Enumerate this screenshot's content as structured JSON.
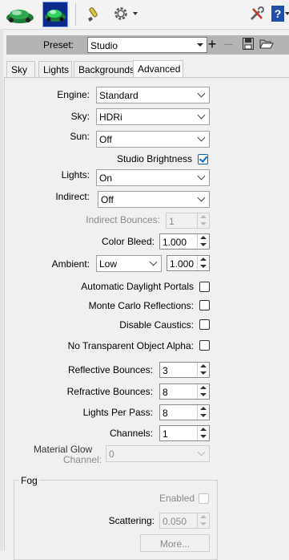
{
  "toolbar": {
    "icons": [
      "car-render-icon",
      "car-render-active-icon",
      "paint-brush-icon",
      "gear-icon",
      "tools-icon",
      "help-icon"
    ],
    "colors": {
      "car_green": "#2fa84f",
      "active_bg": "#0b2a8a",
      "brush_yellow": "#d8c44a"
    }
  },
  "preset": {
    "label": "Preset:",
    "value": "Studio"
  },
  "tabs": [
    "Sky",
    "Lights",
    "Backgrounds",
    "Advanced"
  ],
  "advanced": {
    "engine": {
      "label": "Engine:",
      "value": "Standard"
    },
    "sky": {
      "label": "Sky:",
      "value": "HDRi"
    },
    "sun": {
      "label": "Sun:",
      "value": "Off"
    },
    "studio_brightness": {
      "label": "Studio Brightness",
      "checked": true
    },
    "lights": {
      "label": "Lights:",
      "value": "On"
    },
    "indirect": {
      "label": "Indirect:",
      "value": "Off"
    },
    "indirect_bounces": {
      "label": "Indirect Bounces:",
      "value": "1"
    },
    "color_bleed": {
      "label": "Color Bleed:",
      "value": "1.000"
    },
    "ambient": {
      "label": "Ambient:",
      "value": "Low",
      "amount": "1.000"
    },
    "automatic_daylight_portals": {
      "label": "Automatic Daylight Portals",
      "checked": false
    },
    "monte_carlo_reflections": {
      "label": "Monte Carlo Reflections:",
      "checked": false
    },
    "disable_caustics": {
      "label": "Disable Caustics:",
      "checked": false
    },
    "no_transparent_object_alpha": {
      "label": "No Transparent Object Alpha:",
      "checked": false
    },
    "reflective_bounces": {
      "label": "Reflective Bounces:",
      "value": "3"
    },
    "refractive_bounces": {
      "label": "Refractive Bounces:",
      "value": "8"
    },
    "lights_per_pass": {
      "label": "Lights Per Pass:",
      "value": "8"
    },
    "channels": {
      "label": "Channels:",
      "value": "1"
    },
    "material_glow_channel": {
      "label_line1": "Material Glow",
      "label_line2": "Channel:",
      "value": "0"
    }
  },
  "fog": {
    "title": "Fog",
    "enabled": {
      "label": "Enabled",
      "checked": false
    },
    "scattering": {
      "label": "Scattering:",
      "value": "0.050"
    },
    "more_label": "More..."
  }
}
